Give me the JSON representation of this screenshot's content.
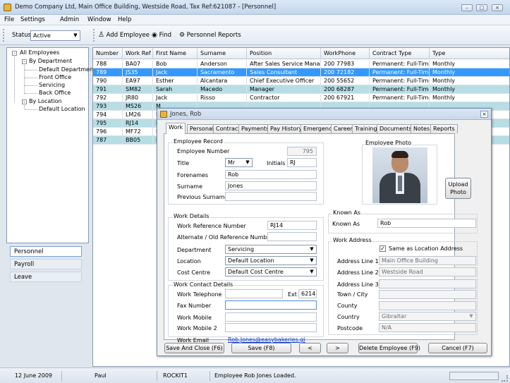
{
  "window": {
    "title": "Demo Company Ltd,  Main Office Building, Westside Road, Tax Ref:621087 - [Personnel]"
  },
  "menu": [
    "File",
    "Settings",
    "Admin",
    "Window",
    "Help"
  ],
  "toolbar": {
    "status_label": "Status",
    "status_value": "Active",
    "add_employee": "Add Employee",
    "find": "Find",
    "personnel_reports": "Personnel Reports"
  },
  "tree": {
    "root": "All Employees",
    "by_department": "By Department",
    "departments": [
      "Default Department",
      "Front Office",
      "Servicing",
      "Back Office"
    ],
    "by_location": "By Location",
    "locations": [
      "Default Location"
    ]
  },
  "nav": [
    "Personnel",
    "Payroll",
    "Leave"
  ],
  "grid": {
    "columns": [
      "Number",
      "Work Ref",
      "First Name",
      "Surname",
      "Position",
      "WorkPhone",
      "Contract Type",
      "Type"
    ],
    "rows": [
      [
        "788",
        "BA07",
        "Bob",
        "Anderson",
        "After Sales Service Manager",
        "200 77983",
        "Permanent: Full-Time",
        "Monthly"
      ],
      [
        "789",
        "JS35",
        "Jack",
        "Sacramento",
        "Sales Consultant",
        "200 72182",
        "Permanent: Full-Time",
        "Monthly"
      ],
      [
        "790",
        "EA97",
        "Esther",
        "Alcantara",
        "Chief Executive Officer",
        "200 55652",
        "Permanent: Full-Time",
        "Monthly"
      ],
      [
        "791",
        "SM82",
        "Sarah",
        "Macedo",
        "Manager",
        "200 68287",
        "Permanent: Full-Time",
        "Monthly"
      ],
      [
        "792",
        "JR80",
        "Jack",
        "Risso",
        "Contractor",
        "200 67921",
        "Permanent: Full-Time",
        "Monthly"
      ],
      [
        "793",
        "MS26",
        "M",
        "",
        "",
        "",
        "",
        ""
      ],
      [
        "794",
        "LM26",
        "L",
        "",
        "",
        "",
        "",
        ""
      ],
      [
        "795",
        "RJ14",
        "R",
        "",
        "",
        "",
        "",
        ""
      ],
      [
        "796",
        "MF72",
        "M",
        "",
        "",
        "",
        "",
        ""
      ],
      [
        "787",
        "BB05",
        "B",
        "",
        "",
        "",
        "",
        ""
      ]
    ]
  },
  "dialog": {
    "title": "Jones, Rob",
    "tabs": [
      "Work",
      "Personal",
      "Contract",
      "Payments",
      "Pay History",
      "Emergency",
      "Career",
      "Training",
      "Documents",
      "Notes",
      "Reports"
    ],
    "employee_record": {
      "heading": "Employee Record",
      "number_label": "Employee Number",
      "number_value": "795",
      "title_label": "Title",
      "title_value": "Mr",
      "initials_label": "Initials",
      "initials_value": "RJ",
      "forenames_label": "Forenames",
      "forenames_value": "Rob",
      "surname_label": "Surname",
      "surname_value": "Jones",
      "previous_surname_label": "Previous Surname",
      "previous_surname_value": ""
    },
    "photo": {
      "heading": "Employee Photo",
      "upload_button": "Upload\nPhoto"
    },
    "work_details": {
      "heading": "Work Details",
      "ref_label": "Work Reference Number",
      "ref_value": "RJ14",
      "alt_ref_label": "Alternate / Old Reference Number",
      "alt_ref_value": "",
      "department_label": "Department",
      "department_value": "Servicing",
      "location_label": "Location",
      "location_value": "Default Location",
      "cost_centre_label": "Cost Centre",
      "cost_centre_value": "Default Cost Centre"
    },
    "known_as": {
      "heading": "Known As",
      "label": "Known As",
      "value": "Rob"
    },
    "work_contact": {
      "heading": "Work Contact Details",
      "telephone_label": "Work Telephone",
      "telephone_value": "",
      "ext_label": "Ext",
      "ext_value": "6214",
      "fax_label": "Fax Number",
      "fax_value": "",
      "mobile_label": "Work Mobile",
      "mobile_value": "",
      "mobile2_label": "Work Mobile 2",
      "mobile2_value": "",
      "email_label": "Work Email",
      "email_value": "Rob.Jones@easybakeries.gi"
    },
    "work_address": {
      "heading": "Work Address",
      "same_as_location": "Same as Location Address",
      "line1_label": "Address Line 1",
      "line1_value": "Main Office Building",
      "line2_label": "Address Line 2",
      "line2_value": "Westside Road",
      "line3_label": "Address Line 3",
      "line3_value": "",
      "town_label": "Town / City",
      "town_value": "",
      "county_label": "County",
      "county_value": "",
      "country_label": "Country",
      "country_value": "Gibraltar",
      "postcode_label": "Postcode",
      "postcode_value": "N/A"
    },
    "buttons": {
      "save_close": "Save And Close (F6)",
      "save": "Save (F8)",
      "prev": "<",
      "next": ">",
      "delete": "Delete Employee (F9)",
      "cancel": "Cancel (F7)"
    }
  },
  "statusbar": {
    "date": "12 June 2009",
    "user": "Paul",
    "machine": "ROCKIT1",
    "message": "Employee Rob Jones Loaded."
  },
  "colors": {
    "selected_row": "#3399ff",
    "alt_row": "#b7dde5"
  }
}
